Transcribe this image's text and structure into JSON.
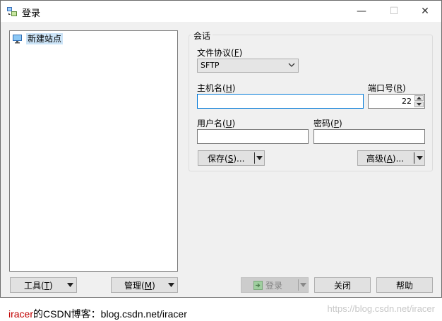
{
  "window": {
    "title": "登录",
    "controls": {
      "minimize": "—",
      "maximize": "☐",
      "close": "✕"
    }
  },
  "tree": {
    "items": [
      {
        "label": "新建站点",
        "icon": "computer-monitor-icon",
        "selected": true
      }
    ]
  },
  "session": {
    "group_title": "会话",
    "protocol": {
      "label": "文件协议",
      "mnemonic": "F",
      "value": "SFTP"
    },
    "host": {
      "label": "主机名",
      "mnemonic": "H",
      "value": ""
    },
    "port": {
      "label": "端口号",
      "mnemonic": "R",
      "value": "22"
    },
    "user": {
      "label": "用户名",
      "mnemonic": "U",
      "value": ""
    },
    "password": {
      "label": "密码",
      "mnemonic": "P",
      "value": ""
    },
    "save_button": {
      "label": "保存",
      "mnemonic": "S",
      "suffix": "..."
    },
    "advanced_button": {
      "label": "高级",
      "mnemonic": "A",
      "suffix": "..."
    }
  },
  "bottom": {
    "tools_button": {
      "label": "工具",
      "mnemonic": "T"
    },
    "manage_button": {
      "label": "管理",
      "mnemonic": "M"
    },
    "login_button": {
      "label": "登录",
      "enabled": false
    },
    "close_button": {
      "label": "关闭"
    },
    "help_button": {
      "label": "帮助"
    }
  },
  "footer": {
    "author": "iracer",
    "text": "的CSDN博客：blog.csdn.net/iracer",
    "watermark": "https://blog.csdn.net/iracer"
  },
  "colors": {
    "focus_border": "#0078d7",
    "selection": "#cce4f7",
    "author_red": "#c00000"
  }
}
